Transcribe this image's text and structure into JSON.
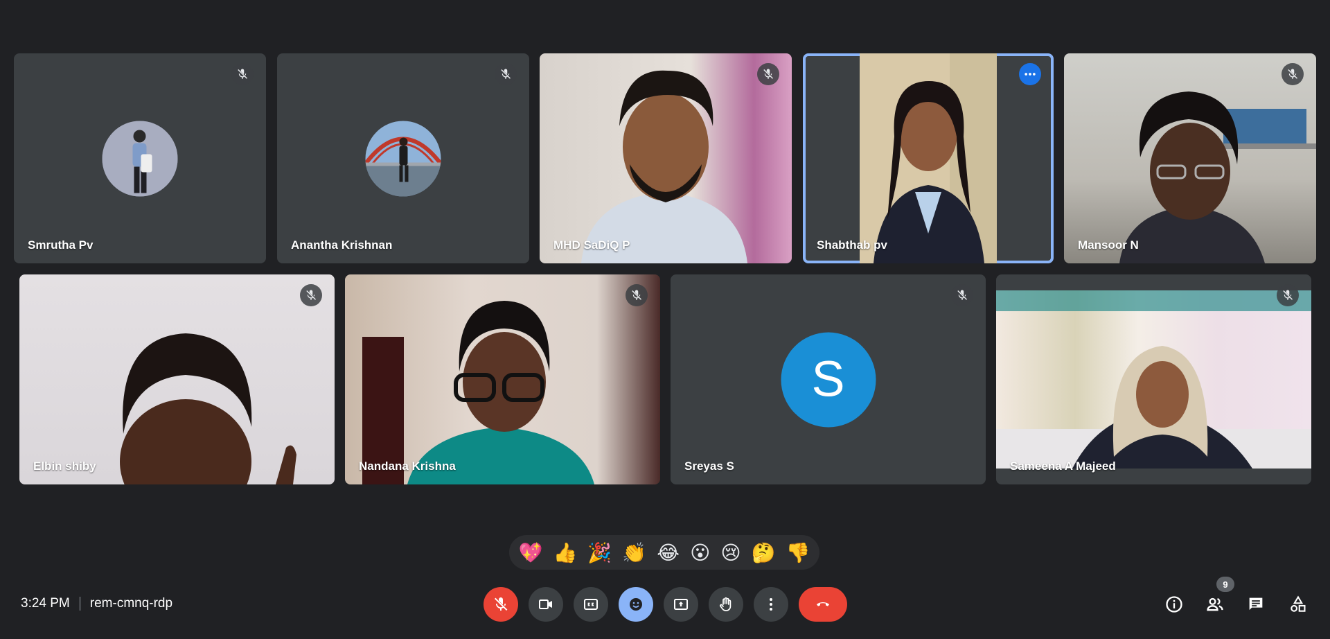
{
  "participants": [
    {
      "name": "Smrutha Pv",
      "muted": true
    },
    {
      "name": "Anantha Krishnan",
      "muted": true
    },
    {
      "name": "MHD SaDiQ P",
      "muted": true
    },
    {
      "name": "Shabthab pv",
      "muted": false,
      "active": true
    },
    {
      "name": "Mansoor N",
      "muted": true
    },
    {
      "name": "Elbin shiby",
      "muted": true
    },
    {
      "name": "Nandana Krishna",
      "muted": true
    },
    {
      "name": "Sreyas S",
      "muted": true,
      "initial": "S"
    },
    {
      "name": "Sameena A Majeed",
      "muted": true
    }
  ],
  "reactions": [
    "💖",
    "👍",
    "🎉",
    "👏",
    "😂",
    "😮",
    "😢",
    "🤔",
    "👎"
  ],
  "meeting": {
    "time": "3:24 PM",
    "code": "rem-cmnq-rdp"
  },
  "people_count": "9",
  "colors": {
    "background": "#202124",
    "tile": "#3c4043",
    "accent": "#8ab4f8",
    "danger": "#ea4335",
    "avatar_s": "#1a8fd6"
  }
}
